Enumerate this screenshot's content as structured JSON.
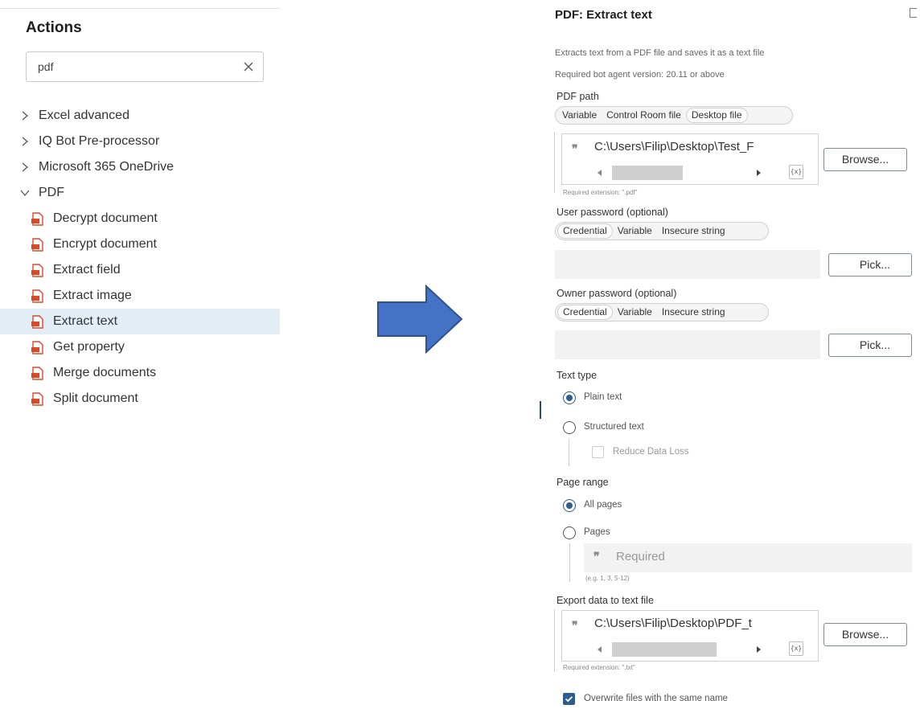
{
  "left_panel": {
    "title": "Actions",
    "search": {
      "value": "pdf",
      "clear_icon": "close-icon"
    },
    "groups": [
      {
        "label": "Excel advanced",
        "expanded": false
      },
      {
        "label": "IQ Bot Pre-processor",
        "expanded": false
      },
      {
        "label": "Microsoft 365 OneDrive",
        "expanded": false
      },
      {
        "label": "PDF",
        "expanded": true
      }
    ],
    "pdf_actions": [
      {
        "label": "Decrypt document"
      },
      {
        "label": "Encrypt document"
      },
      {
        "label": "Extract field"
      },
      {
        "label": "Extract image"
      },
      {
        "label": "Extract text",
        "selected": true
      },
      {
        "label": "Get property"
      },
      {
        "label": "Merge documents"
      },
      {
        "label": "Split document"
      }
    ],
    "selected_bg": "#e3edf5"
  },
  "arrow_color": "#4472c4",
  "right_panel": {
    "title": "PDF: Extract text",
    "description": "Extracts text from a PDF file and saves it as a text file",
    "version_note": "Required bot agent version: 20.11 or above",
    "pdf_path": {
      "label": "PDF path",
      "tabs": [
        "Variable",
        "Control Room file",
        "Desktop file"
      ],
      "active_tab": "Desktop file",
      "value": "C:\\Users\\Filip\\Desktop\\Test_F",
      "browse_label": "Browse...",
      "hint": "Required extension: \".pdf\""
    },
    "user_password": {
      "label": "User password (optional)",
      "tabs": [
        "Credential",
        "Variable",
        "Insecure string"
      ],
      "active_tab": "Credential",
      "pick_label": "Pick..."
    },
    "owner_password": {
      "label": "Owner password (optional)",
      "tabs": [
        "Credential",
        "Variable",
        "Insecure string"
      ],
      "active_tab": "Credential",
      "pick_label": "Pick..."
    },
    "text_type": {
      "label": "Text type",
      "options": [
        "Plain text",
        "Structured text"
      ],
      "selected": "Plain text",
      "reduce_loss_label": "Reduce Data Loss"
    },
    "page_range": {
      "label": "Page range",
      "options": [
        "All pages",
        "Pages"
      ],
      "selected": "All pages",
      "pages_placeholder": "Required",
      "pages_hint": "(e.g. 1, 3, 5-12)"
    },
    "export": {
      "label": "Export data to text file",
      "value": "C:\\Users\\Filip\\Desktop\\PDF_t",
      "browse_label": "Browse...",
      "hint": "Required extension: \".txt\""
    },
    "overwrite": {
      "label": "Overwrite files with the same name",
      "checked": true
    },
    "var_icon_text": "{x}",
    "accent": "#2d5e8e"
  }
}
